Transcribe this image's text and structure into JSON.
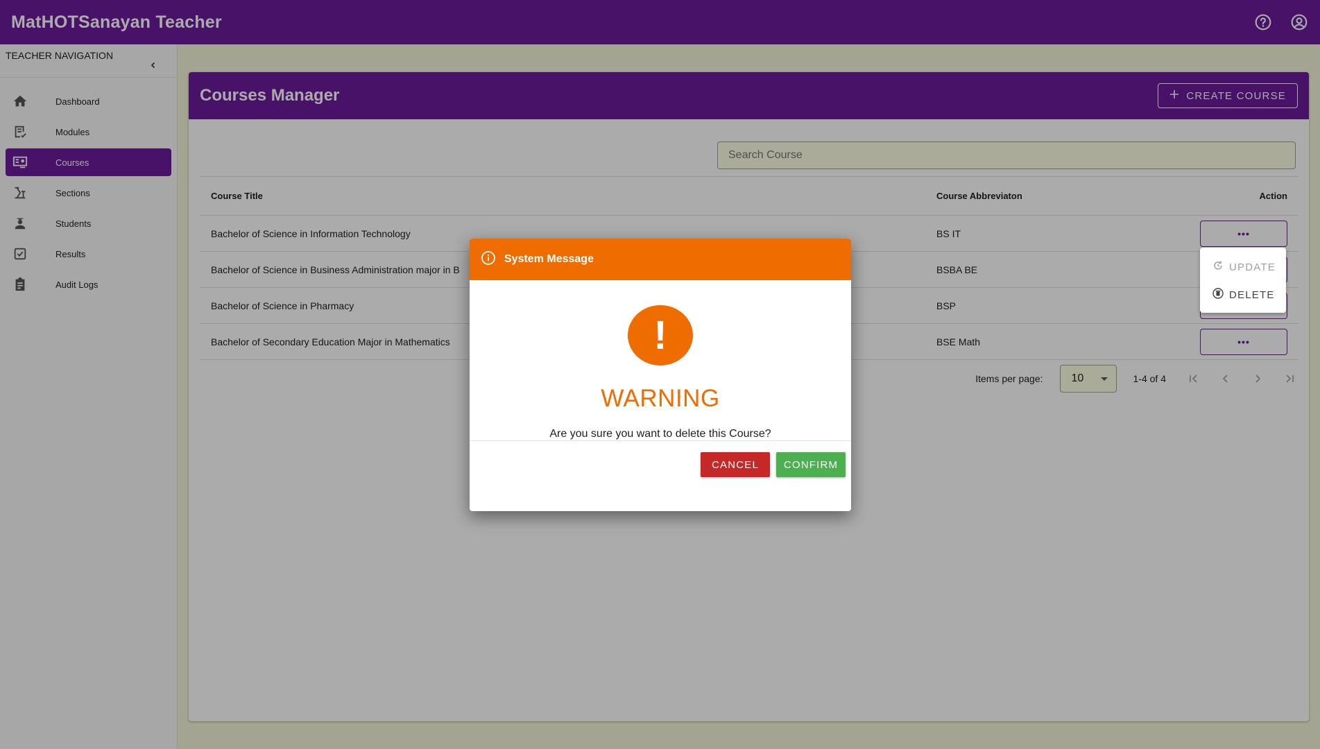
{
  "app": {
    "title": "MatHOTSanayan Teacher"
  },
  "topbar": {
    "icons": [
      "help-icon",
      "account-icon"
    ]
  },
  "sidebar": {
    "header": "TEACHER NAVIGATION",
    "items": [
      {
        "label": "Dashboard",
        "icon": "home-icon",
        "active": false
      },
      {
        "label": "Modules",
        "icon": "modules-icon",
        "active": false
      },
      {
        "label": "Courses",
        "icon": "courses-icon",
        "active": true
      },
      {
        "label": "Sections",
        "icon": "sections-icon",
        "active": false
      },
      {
        "label": "Students",
        "icon": "students-icon",
        "active": false
      },
      {
        "label": "Results",
        "icon": "results-icon",
        "active": false
      },
      {
        "label": "Audit Logs",
        "icon": "audit-logs-icon",
        "active": false
      }
    ]
  },
  "page": {
    "title": "Courses Manager",
    "create_label": "CREATE COURSE",
    "search_placeholder": "Search Course"
  },
  "table": {
    "headers": [
      "Course Title",
      "Course Abbreviaton",
      "Action"
    ],
    "rows": [
      {
        "title": "Bachelor of Science in Information Technology",
        "abbr": "BS IT",
        "action": "•••"
      },
      {
        "title": "Bachelor of Science in Business Administration major in B",
        "abbr": "BSBA BE",
        "action": "•••"
      },
      {
        "title": "Bachelor of Science in Pharmacy",
        "abbr": "BSP",
        "action": "•••"
      },
      {
        "title": "Bachelor of Secondary Education Major in Mathematics",
        "abbr": "BSE Math",
        "action": "•••"
      }
    ]
  },
  "paginator": {
    "items_label": "Items per page:",
    "page_size": "10",
    "range": "1-4 of 4"
  },
  "action_menu": {
    "update_label": "UPDATE",
    "delete_label": "DELETE"
  },
  "dialog": {
    "title": "System Message",
    "heading": "WARNING",
    "message": "Are you sure you want to delete this Course?",
    "cancel_label": "CANCEL",
    "confirm_label": "CONFIRM"
  },
  "colors": {
    "primary": "#6a1b9a",
    "warning": "#ef6c00",
    "cancel": "#c62828",
    "confirm": "#4caf50",
    "background": "#f5f5dc"
  }
}
